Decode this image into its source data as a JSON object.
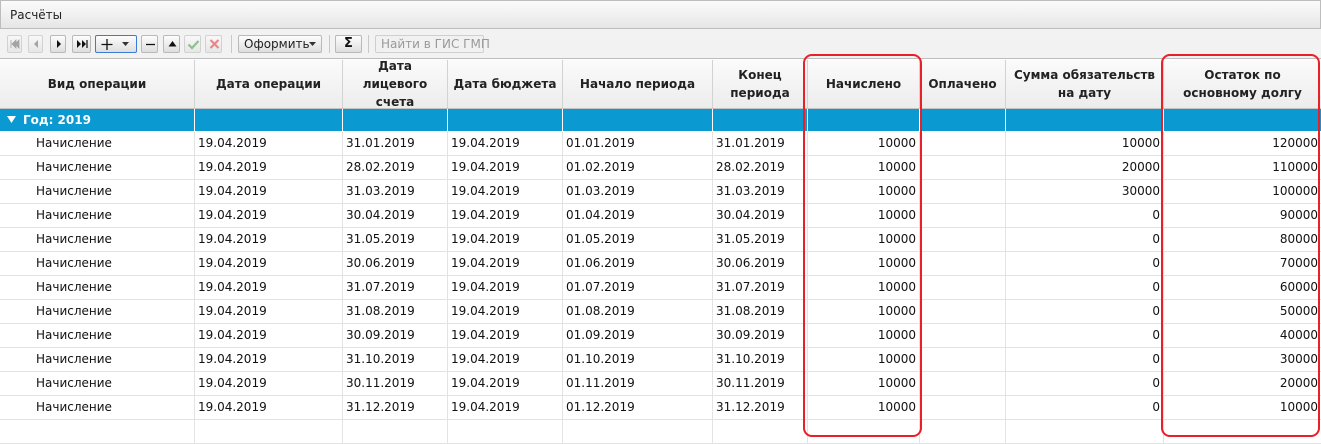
{
  "panel": {
    "title": "Расчёты"
  },
  "toolbar": {
    "nav_first": "first-page",
    "nav_prev": "previous-page",
    "nav_next": "next-page",
    "nav_last": "last-page",
    "oform_label": "Оформить",
    "sum_label": "Σ",
    "gis_label": "Найти в ГИС ГМП"
  },
  "columns": [
    "Вид операции",
    "Дата операции",
    "Дата лицевого счета",
    "Дата бюджета",
    "Начало периода",
    "Конец периода",
    "Начислено",
    "Оплачено",
    "Сумма обязательств на дату",
    "Остаток по основному долгу"
  ],
  "group": {
    "label": "Год: 2019"
  },
  "rows": [
    [
      "Начисление",
      "19.04.2019",
      "31.01.2019",
      "19.04.2019",
      "01.01.2019",
      "31.01.2019",
      "10000",
      "",
      "10000",
      "120000"
    ],
    [
      "Начисление",
      "19.04.2019",
      "28.02.2019",
      "19.04.2019",
      "01.02.2019",
      "28.02.2019",
      "10000",
      "",
      "20000",
      "110000"
    ],
    [
      "Начисление",
      "19.04.2019",
      "31.03.2019",
      "19.04.2019",
      "01.03.2019",
      "31.03.2019",
      "10000",
      "",
      "30000",
      "100000"
    ],
    [
      "Начисление",
      "19.04.2019",
      "30.04.2019",
      "19.04.2019",
      "01.04.2019",
      "30.04.2019",
      "10000",
      "",
      "0",
      "90000"
    ],
    [
      "Начисление",
      "19.04.2019",
      "31.05.2019",
      "19.04.2019",
      "01.05.2019",
      "31.05.2019",
      "10000",
      "",
      "0",
      "80000"
    ],
    [
      "Начисление",
      "19.04.2019",
      "30.06.2019",
      "19.04.2019",
      "01.06.2019",
      "30.06.2019",
      "10000",
      "",
      "0",
      "70000"
    ],
    [
      "Начисление",
      "19.04.2019",
      "31.07.2019",
      "19.04.2019",
      "01.07.2019",
      "31.07.2019",
      "10000",
      "",
      "0",
      "60000"
    ],
    [
      "Начисление",
      "19.04.2019",
      "31.08.2019",
      "19.04.2019",
      "01.08.2019",
      "31.08.2019",
      "10000",
      "",
      "0",
      "50000"
    ],
    [
      "Начисление",
      "19.04.2019",
      "30.09.2019",
      "19.04.2019",
      "01.09.2019",
      "30.09.2019",
      "10000",
      "",
      "0",
      "40000"
    ],
    [
      "Начисление",
      "19.04.2019",
      "31.10.2019",
      "19.04.2019",
      "01.10.2019",
      "31.10.2019",
      "10000",
      "",
      "0",
      "30000"
    ],
    [
      "Начисление",
      "19.04.2019",
      "30.11.2019",
      "19.04.2019",
      "01.11.2019",
      "30.11.2019",
      "10000",
      "",
      "0",
      "20000"
    ],
    [
      "Начисление",
      "19.04.2019",
      "31.12.2019",
      "19.04.2019",
      "01.12.2019",
      "31.12.2019",
      "10000",
      "",
      "0",
      "10000"
    ]
  ],
  "colors": {
    "group_bg": "#0a99d0",
    "highlight": "#e8202a"
  }
}
